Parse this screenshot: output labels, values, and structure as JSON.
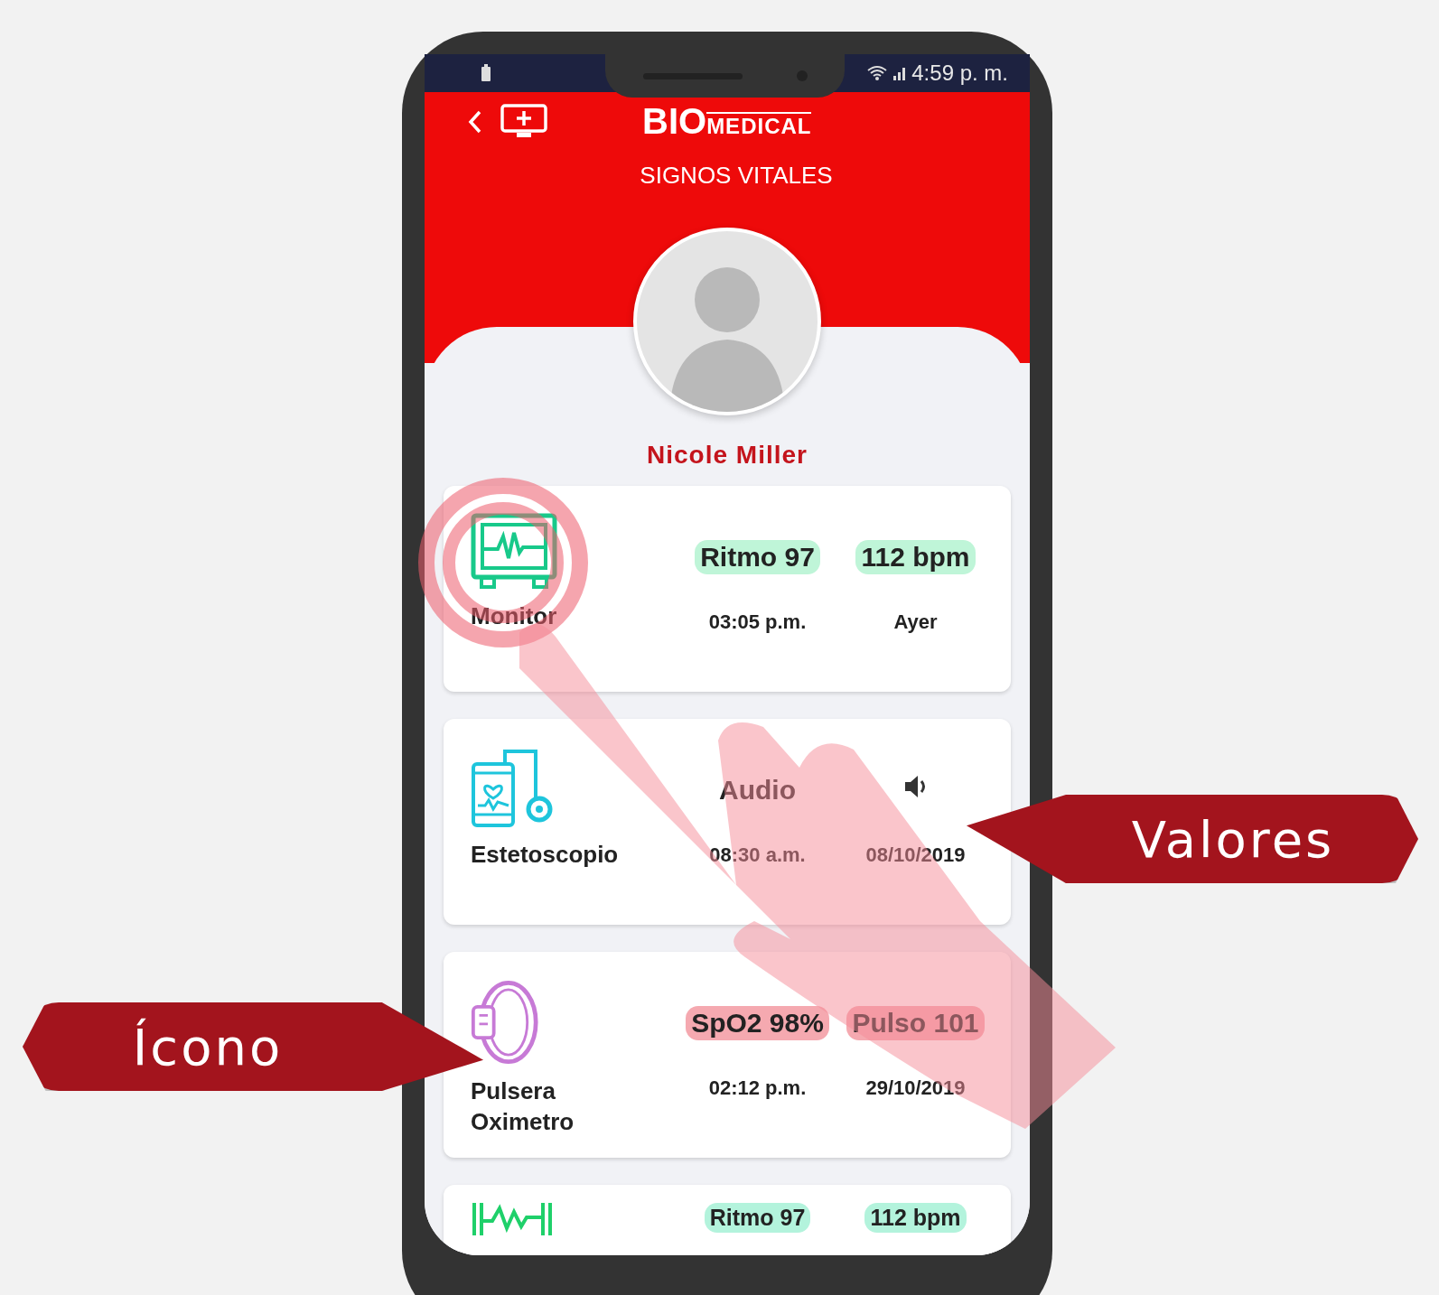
{
  "status_bar": {
    "time": "4:59 p. m."
  },
  "header": {
    "logo_main": "BIO",
    "logo_sub": "MEDICAL",
    "title": "SIGNOS VITALES"
  },
  "patient": {
    "name": "Nicole Miller"
  },
  "devices": [
    {
      "kind": "monitor",
      "label": "Monitor",
      "values": [
        {
          "kind": "text",
          "text": "Ritmo 97",
          "color": "#bff5d8"
        },
        {
          "kind": "text",
          "text": "112 bpm",
          "color": "#bff5d8"
        }
      ],
      "details": [
        "03:05 p.m.",
        "Ayer"
      ]
    },
    {
      "kind": "stethoscope",
      "label": "Estetoscopio",
      "values": [
        {
          "kind": "text",
          "text": "Audio"
        },
        {
          "kind": "speaker"
        }
      ],
      "details": [
        "08:30 a.m.",
        "08/10/2019"
      ]
    },
    {
      "kind": "wristband",
      "label": "Pulsera Oximetro",
      "values": [
        {
          "kind": "text",
          "text": "SpO2 98%",
          "color": "#f5a9b0"
        },
        {
          "kind": "text",
          "text": "Pulso 101",
          "color": "#f5a9b0"
        }
      ],
      "details": [
        "02:12 p.m.",
        "29/10/2019"
      ]
    },
    {
      "kind": "ecg",
      "values": [
        {
          "kind": "text",
          "text": "Ritmo 97",
          "color": "#b3f3dc"
        },
        {
          "kind": "text",
          "text": "112 bpm",
          "color": "#b3f3dc"
        }
      ]
    }
  ],
  "callouts": [
    {
      "kind": "right",
      "text": "Valores"
    },
    {
      "kind": "left",
      "text": "Ícono"
    }
  ]
}
